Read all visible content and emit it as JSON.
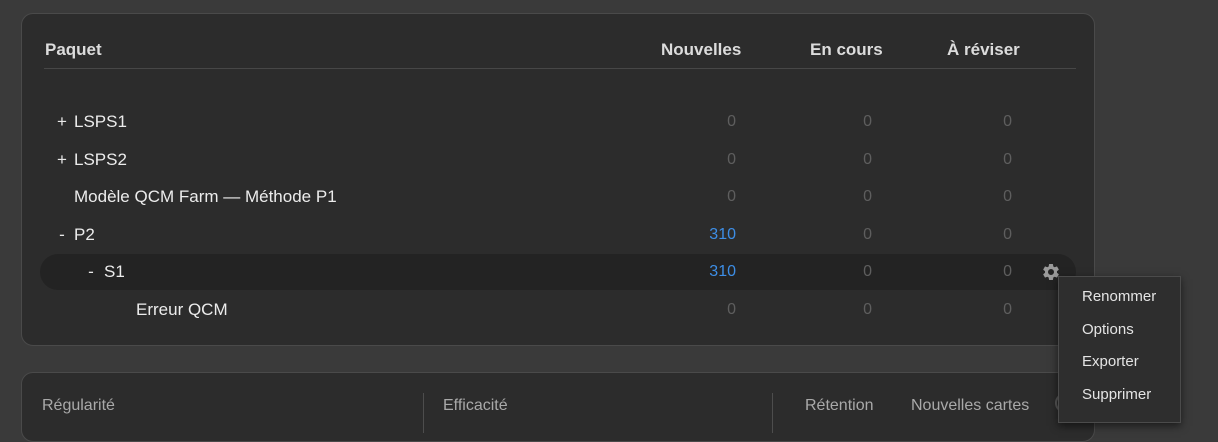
{
  "deck_list": {
    "columns": {
      "name": "Paquet",
      "new": "Nouvelles",
      "learning": "En cours",
      "due": "À réviser"
    },
    "rows": [
      {
        "toggle": "+",
        "name": "LSPS1",
        "new": "0",
        "learning": "0",
        "due": "0",
        "new_highlight": false,
        "selected": false
      },
      {
        "toggle": "+",
        "name": "LSPS2",
        "new": "0",
        "learning": "0",
        "due": "0",
        "new_highlight": false,
        "selected": false
      },
      {
        "toggle": "",
        "name": "Modèle QCM Farm — Méthode P1",
        "new": "0",
        "learning": "0",
        "due": "0",
        "new_highlight": false,
        "selected": false
      },
      {
        "toggle": "-",
        "name": "P2",
        "new": "310",
        "learning": "0",
        "due": "0",
        "new_highlight": true,
        "selected": false
      },
      {
        "toggle": "-",
        "name": "S1",
        "new": "310",
        "learning": "0",
        "due": "0",
        "new_highlight": true,
        "selected": true
      },
      {
        "toggle": "",
        "name": "Erreur QCM",
        "new": "0",
        "learning": "0",
        "due": "0",
        "new_highlight": false,
        "selected": false
      }
    ],
    "row_gear_icon": "gear-icon"
  },
  "context_menu": {
    "items": [
      "Renommer",
      "Options",
      "Exporter",
      "Supprimer"
    ]
  },
  "stats_bar": {
    "regularity": "Régularité",
    "efficiency": "Efficacité",
    "retention": "Rétention",
    "new_cards": "Nouvelles cartes"
  },
  "colors": {
    "background": "#3a3a3a",
    "panel": "#2c2c2c",
    "accent_blue": "#3d8ee6",
    "muted_number": "#5e5e5e"
  }
}
